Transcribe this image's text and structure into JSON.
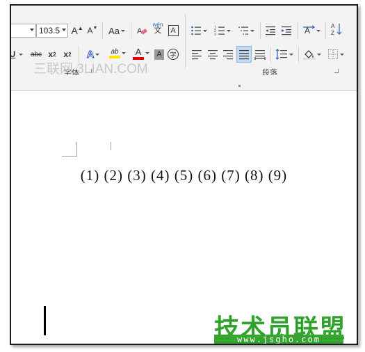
{
  "ribbon": {
    "font_size_value": "103.5",
    "grow_font": "A",
    "shrink_font": "A",
    "change_case": "Aa",
    "phonetic_top": "wén",
    "phonetic_bottom": "文",
    "char_border": "A",
    "strikethrough": "abc",
    "subscript": "x",
    "subscript_mark": "2",
    "superscript": "x",
    "superscript_mark": "2",
    "text_effect": "A",
    "highlight": "ab",
    "font_color": "A",
    "char_shading": "A",
    "enclose_char": "字",
    "group_font_label": "字体",
    "group_paragraph_label": "段落"
  },
  "watermark": "三联网 3LIAN.COM",
  "document": {
    "paragraph": "(1) (2) (3) (4) (5) (6) (7) (8) (9)"
  },
  "logo": {
    "title": "技术员联盟",
    "url": "www.jsgho.com"
  },
  "colors": {
    "logo_green": "#2fa32c",
    "highlight_yellow": "#ffe600",
    "font_color_red": "#e00000",
    "active_button_blue": "#c5d9f1"
  }
}
